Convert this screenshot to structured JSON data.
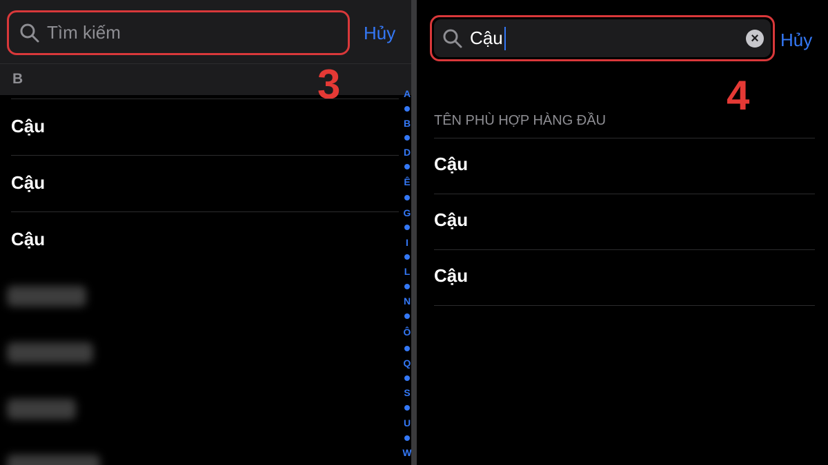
{
  "left": {
    "search_placeholder": "Tìm kiếm",
    "cancel_label": "Hủy",
    "step_number": "3",
    "section_header": "B",
    "contacts": [
      "Cậu",
      "Cậu",
      "Cậu"
    ],
    "index_letters": [
      "A",
      "B",
      "D",
      "Ê",
      "G",
      "I",
      "L",
      "N",
      "Ô",
      "Q",
      "S",
      "U",
      "W"
    ]
  },
  "right": {
    "search_value": "Cậu",
    "cancel_label": "Hủy",
    "step_number": "4",
    "top_header": "TÊN PHÙ HỢP HÀNG ĐẦU",
    "results": [
      "Cậu",
      "Cậu",
      "Cậu"
    ]
  },
  "colors": {
    "accent": "#3478f6",
    "highlight_border": "#d9383a",
    "step_number": "#e53935",
    "background": "#000000"
  }
}
